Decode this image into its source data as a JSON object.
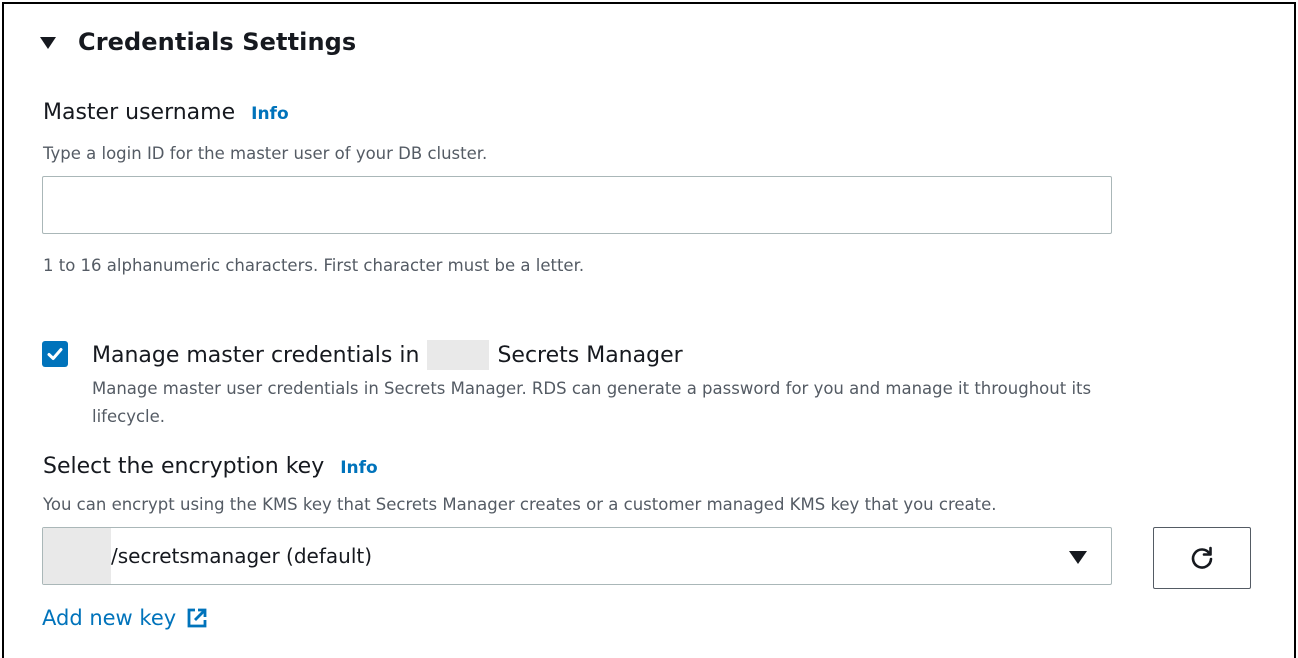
{
  "section": {
    "title": "Credentials Settings"
  },
  "master_username": {
    "label": "Master username",
    "info": "Info",
    "description": "Type a login ID for the master user of your DB cluster.",
    "value": "",
    "constraint": "1 to 16 alphanumeric characters. First character must be a letter."
  },
  "manage_credentials": {
    "checked": true,
    "label_before": "Manage master credentials in",
    "label_after": "Secrets Manager",
    "description": "Manage master user credentials in Secrets Manager. RDS can generate a password for you and manage it throughout its lifecycle."
  },
  "encryption_key": {
    "label": "Select the encryption key",
    "info": "Info",
    "description": "You can encrypt using the KMS key that Secrets Manager creates or a customer managed KMS key that you create.",
    "selected_value": "/secretsmanager (default)",
    "refresh_icon": "refresh-icon",
    "add_new_key": "Add new key",
    "add_new_key_icon": "external-link-icon"
  },
  "colors": {
    "link": "#0073bb",
    "checkbox": "#0073bb",
    "text": "#16191f",
    "secondary_text": "#545b64",
    "border": "#aab7b8"
  }
}
